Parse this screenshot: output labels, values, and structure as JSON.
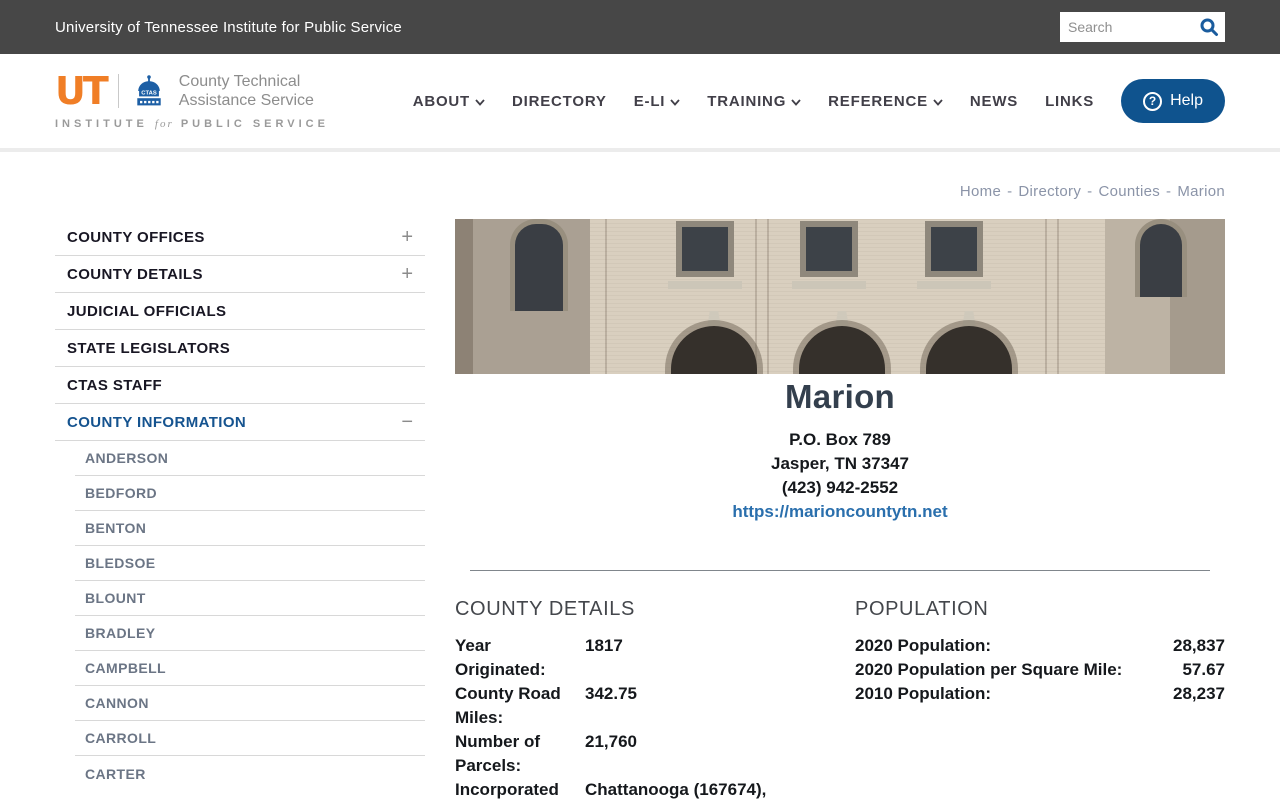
{
  "topbar": {
    "title": "University of Tennessee Institute for Public Service",
    "search_placeholder": "Search"
  },
  "header": {
    "logo": {
      "ut": "UT",
      "ctas": "CTAS",
      "org_line1": "County Technical",
      "org_line2": "Assistance Service",
      "institute_pre": "INSTITUTE",
      "institute_for": "for",
      "institute_post": "PUBLIC SERVICE"
    },
    "nav": [
      {
        "label": "ABOUT",
        "dropdown": true
      },
      {
        "label": "DIRECTORY",
        "dropdown": false
      },
      {
        "label": "E-LI",
        "dropdown": true
      },
      {
        "label": "TRAINING",
        "dropdown": true
      },
      {
        "label": "REFERENCE",
        "dropdown": true
      },
      {
        "label": "NEWS",
        "dropdown": false
      },
      {
        "label": "LINKS",
        "dropdown": false
      }
    ],
    "help_label": "Help",
    "help_icon_glyph": "?"
  },
  "breadcrumb": {
    "items": [
      "Home",
      "Directory",
      "Counties",
      "Marion"
    ],
    "separator": "-"
  },
  "sidebar": {
    "sections": [
      {
        "label": "COUNTY OFFICES",
        "toggle": "+"
      },
      {
        "label": "COUNTY DETAILS",
        "toggle": "+"
      },
      {
        "label": "JUDICIAL OFFICIALS",
        "toggle": ""
      },
      {
        "label": "STATE LEGISLATORS",
        "toggle": ""
      },
      {
        "label": "CTAS STAFF",
        "toggle": ""
      },
      {
        "label": "COUNTY INFORMATION",
        "toggle": "−"
      }
    ],
    "counties": [
      "ANDERSON",
      "BEDFORD",
      "BENTON",
      "BLEDSOE",
      "BLOUNT",
      "BRADLEY",
      "CAMPBELL",
      "CANNON",
      "CARROLL",
      "CARTER"
    ]
  },
  "main": {
    "county_name": "Marion",
    "address_line1": "P.O. Box 789",
    "address_line2": "Jasper, TN 37347",
    "phone": "(423) 942-2552",
    "website": "https://marioncountytn.net",
    "details": {
      "heading": "COUNTY DETAILS",
      "rows": [
        {
          "label": "Year Originated:",
          "value": "1817"
        },
        {
          "label": "County Road Miles:",
          "value": "342.75"
        },
        {
          "label": "Number of Parcels:",
          "value": "21,760"
        },
        {
          "label": "Incorporated",
          "value": "Chattanooga (167674),"
        }
      ]
    },
    "population": {
      "heading": "POPULATION",
      "rows": [
        {
          "label": "2020 Population:",
          "value": "28,837"
        },
        {
          "label": "2020 Population per Square Mile:",
          "value": "57.67"
        },
        {
          "label": "2010 Population:",
          "value": "28,237"
        }
      ]
    }
  },
  "colors": {
    "topbar_bg": "#474747",
    "brand_orange": "#f07e26",
    "brand_blue": "#1d5fa5",
    "accent_blue": "#0f538e",
    "link_blue": "#2a6fad",
    "active_sidebar_blue": "#15538f"
  }
}
